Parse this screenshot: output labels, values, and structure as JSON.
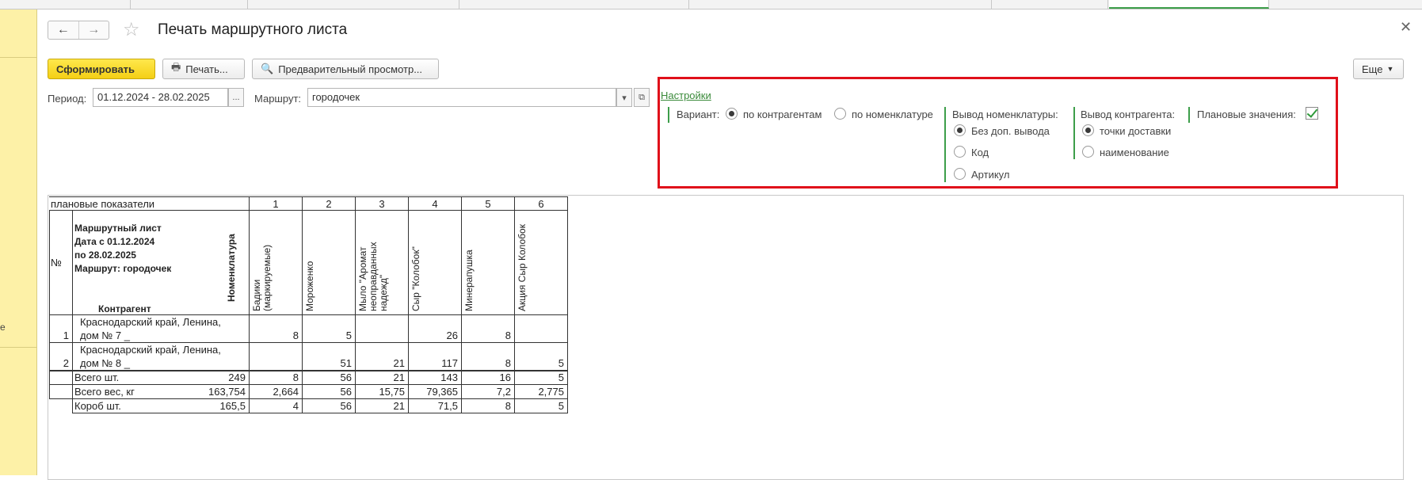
{
  "window": {
    "title": "Печать маршрутного листа",
    "left_panel_cut_text": "е",
    "colors": {
      "primary_button": "#f4cf15",
      "accent_green": "#3d9e4a",
      "highlight_red": "#e0101a",
      "left_panel": "#fdf1a7"
    }
  },
  "toolbar": {
    "generate_label": "Сформировать",
    "print_label": "Печать...",
    "preview_label": "Предварительный просмотр...",
    "more_label": "Еще"
  },
  "filters": {
    "period_label": "Период:",
    "period_value": "01.12.2024 - 28.02.2025",
    "period_select": "...",
    "route_label": "Маршрут:",
    "route_value": "городочек"
  },
  "settings": {
    "link": "Настройки",
    "variant_label": "Вариант:",
    "variant_options": [
      "по контрагентам",
      "по номенклатуре"
    ],
    "variant_selected": "по контрагентам",
    "nomenclature_label": "Вывод номенклатуры:",
    "nomenclature_options": [
      "Без доп. вывода",
      "Код",
      "Артикул"
    ],
    "nomenclature_selected": "Без доп. вывода",
    "counterparty_label": "Вывод контрагента:",
    "counterparty_options": [
      "точки доставки",
      "наименование"
    ],
    "counterparty_selected": "точки доставки",
    "plan_label": "Плановые значения:",
    "plan_checked": true
  },
  "report": {
    "plan_header": "плановые показатели",
    "col_numbers": [
      "1",
      "2",
      "3",
      "4",
      "5",
      "6"
    ],
    "no_label": "№",
    "title_lines": [
      "Маршрутный лист",
      "Дата с 01.12.2024",
      "по 28.02.2025",
      "Маршрут: городочек"
    ],
    "nomenclature_header": "Номенклатура",
    "counterparty_header": "Контрагент",
    "products": [
      "Бадики (маркируемые)",
      "Мороженко",
      "Мыло \"Аромат неоправданных надежд\"",
      "Сыр \"Колобок\"",
      "Минерапушка",
      "Акция Сыр Колобок"
    ],
    "rows": [
      {
        "no": "1",
        "line1": "Краснодарский край, Ленина,",
        "line2": "дом № 7 _",
        "values": [
          "8",
          "5",
          "",
          "26",
          "8",
          ""
        ]
      },
      {
        "no": "2",
        "line1": "Краснодарский край, Ленина,",
        "line2": "дом № 8 _",
        "values": [
          "",
          "51",
          "21",
          "117",
          "8",
          "5"
        ]
      }
    ],
    "totals": [
      {
        "label": "Всего шт.",
        "total": "249",
        "values": [
          "8",
          "56",
          "21",
          "143",
          "16",
          "5"
        ]
      },
      {
        "label": "Всего вес, кг",
        "total": "163,754",
        "values": [
          "2,664",
          "56",
          "15,75",
          "79,365",
          "7,2",
          "2,775"
        ]
      },
      {
        "label": "Короб шт.",
        "total": "165,5",
        "values": [
          "4",
          "56",
          "21",
          "71,5",
          "8",
          "5"
        ]
      }
    ]
  }
}
